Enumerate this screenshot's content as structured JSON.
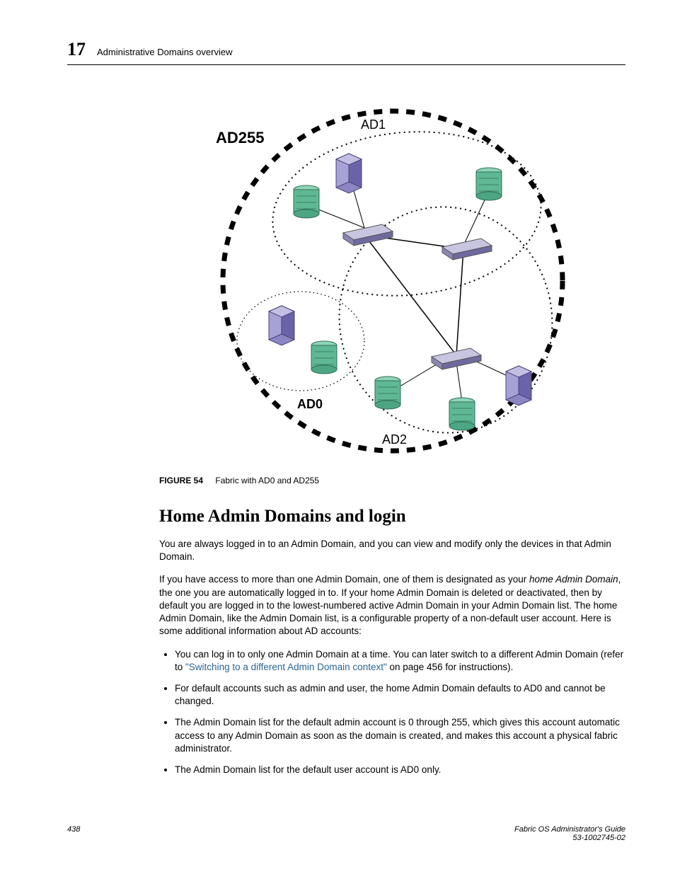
{
  "header": {
    "chapter_number": "17",
    "chapter_title": "Administrative Domains overview"
  },
  "figure": {
    "label": "FIGURE 54",
    "caption": "Fabric with AD0 and AD255",
    "labels": {
      "ad255": "AD255",
      "ad1": "AD1",
      "ad0": "AD0",
      "ad2": "AD2"
    }
  },
  "section": {
    "heading": "Home Admin Domains and login",
    "para1": "You are always logged in to an Admin Domain, and you can view and modify only the devices in that Admin Domain.",
    "para2_a": "If you have access to more than one Admin Domain, one of them is designated as your ",
    "para2_term": "home Admin Domain",
    "para2_b": ", the one you are automatically logged in to. If your home Admin Domain is deleted or deactivated, then by default you are logged in to the lowest-numbered active Admin Domain in your Admin Domain list. The home Admin Domain, like the Admin Domain list, is a configurable property of a non-default user account. Here is some additional information about AD accounts:",
    "bullets": {
      "b1_a": "You can log in to only one Admin Domain at a time. You can later switch to a different Admin Domain (refer to ",
      "b1_link": "\"Switching to a different Admin Domain context\"",
      "b1_b": " on page 456 for instructions).",
      "b2": "For default accounts such as admin and user, the home Admin Domain defaults to AD0 and cannot be changed.",
      "b3": "The Admin Domain list for the default admin account is 0 through 255, which gives this account automatic access to any Admin Domain as soon as the domain is created, and makes this account a physical fabric administrator.",
      "b4": "The Admin Domain list for the default user account is AD0 only."
    }
  },
  "footer": {
    "page": "438",
    "doc_title": "Fabric OS Administrator's Guide",
    "doc_id": "53-1002745-02"
  }
}
